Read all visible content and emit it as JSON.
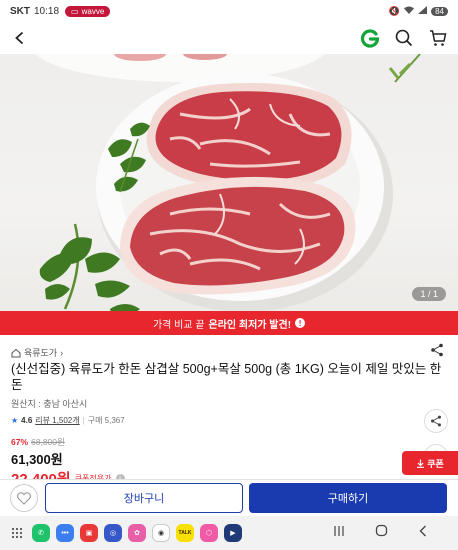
{
  "status_bar": {
    "carrier": "SKT",
    "time": "10:18",
    "app_badge": "wavve",
    "battery": "84"
  },
  "product_image": {
    "counter": "1 / 1"
  },
  "banner": {
    "prefix": "가격 비교 끝",
    "highlight": "온라인 최저가 발견!"
  },
  "product": {
    "store_name": "육류도가",
    "title": "(신선집중) 육류도가 한돈 삼겹살 500g+목살 500g (총 1KG) 오늘이 제일 맛있는 한돈",
    "origin": "원산지 : 충남 아산시",
    "rating": "4.6",
    "reviews": "리뷰 1,502개",
    "sales": "구매 5,367",
    "discount_rate": "67%",
    "original_price": "68,800원",
    "sale_price": "61,300원",
    "coupon_price": "22,400원",
    "coupon_label": "쿠폰적용가"
  },
  "coupon_button": {
    "label": "쿠폰"
  },
  "actions": {
    "cart_label": "장바구니",
    "buy_label": "구매하기"
  },
  "nav_apps": {
    "kakaotalk": "TALK"
  },
  "colors": {
    "accent_red": "#e8262e",
    "primary_blue": "#1a3bb0",
    "brand_green": "#13a538"
  }
}
